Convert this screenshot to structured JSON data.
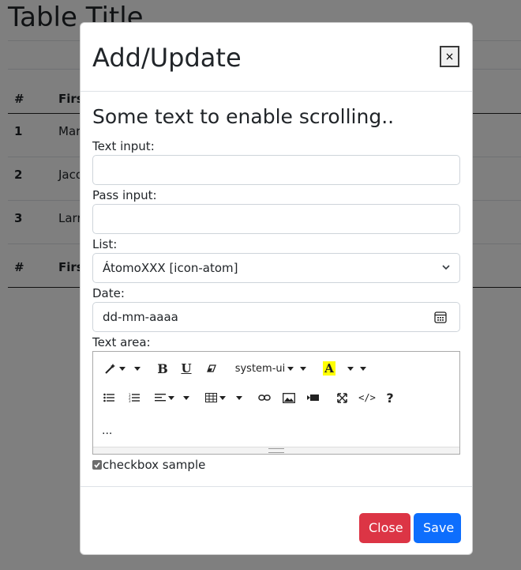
{
  "page": {
    "title": "Table Title",
    "table": {
      "header": [
        "#",
        "First"
      ],
      "rows": [
        [
          "1",
          "Mar"
        ],
        [
          "2",
          "Jaco"
        ],
        [
          "3",
          "Larr"
        ]
      ],
      "footer": [
        "#",
        "First"
      ]
    }
  },
  "modal": {
    "title": "Add/Update",
    "close_symbol": "×",
    "heading": "Some text to enable scrolling..",
    "text_input": {
      "label": "Text input:",
      "value": ""
    },
    "pass_input": {
      "label": "Pass input:",
      "value": ""
    },
    "list": {
      "label": "List:",
      "selected": "ÁtomoXXX [icon-atom]"
    },
    "date": {
      "label": "Date:",
      "placeholder": "dd-mm-aaaa"
    },
    "textarea": {
      "label": "Text area:",
      "font_name": "system-ui",
      "content": "..."
    },
    "checkbox": {
      "label": "checkbox sample",
      "checked": true
    },
    "buttons": {
      "close": "Close",
      "save": "Save"
    }
  },
  "colors": {
    "close_button": "#dc3545",
    "save_button": "#0d6efd",
    "highlight": "#ffff00"
  }
}
